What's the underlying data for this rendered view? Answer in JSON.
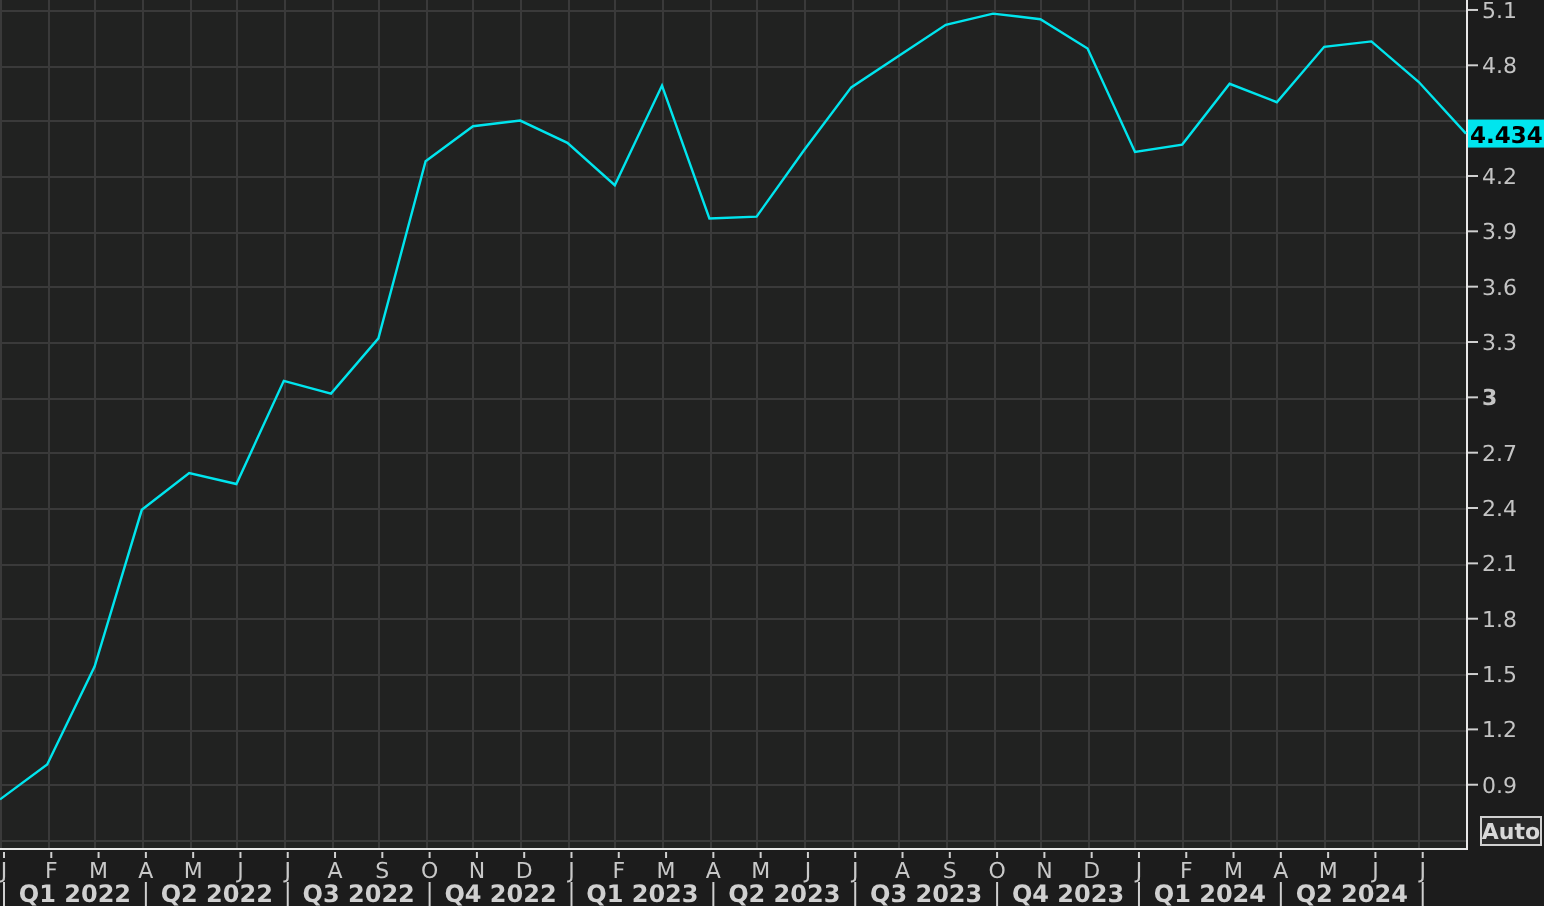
{
  "chart": {
    "chart_data": {
      "type": "line",
      "categories": [
        "J",
        "F",
        "M",
        "A",
        "M",
        "J",
        "J",
        "A",
        "S",
        "O",
        "N",
        "D",
        "J",
        "F",
        "M",
        "A",
        "M",
        "J",
        "J",
        "A",
        "S",
        "O",
        "N",
        "D",
        "J",
        "F",
        "M",
        "A",
        "M",
        "J",
        "J",
        null
      ],
      "series": [
        {
          "color": "#00e5ee",
          "values": [
            0.82,
            1.01,
            1.54,
            2.39,
            2.59,
            2.53,
            3.09,
            3.02,
            3.32,
            4.28,
            4.47,
            4.5,
            4.38,
            4.15,
            4.69,
            3.97,
            3.98,
            4.34,
            4.68,
            4.85,
            5.02,
            5.08,
            5.05,
            4.89,
            4.33,
            4.37,
            4.7,
            4.6,
            4.9,
            4.93,
            4.71,
            4.43
          ]
        }
      ],
      "ylim": [
        0.557,
        5.154
      ],
      "grid": true,
      "yticks": [
        0.9,
        1.2,
        1.5,
        1.8,
        2.1,
        2.4,
        2.7,
        3,
        3.3,
        3.6,
        3.9,
        4.2,
        4.8,
        5.1
      ]
    },
    "quarters": [
      "Q1 2022",
      "Q2 2022",
      "Q3 2022",
      "Q4 2022",
      "Q1 2023",
      "Q2 2023",
      "Q3 2023",
      "Q4 2023",
      "Q1 2024",
      "Q2 2024"
    ],
    "last_value_label": "4.434",
    "scale_button": "Auto"
  }
}
